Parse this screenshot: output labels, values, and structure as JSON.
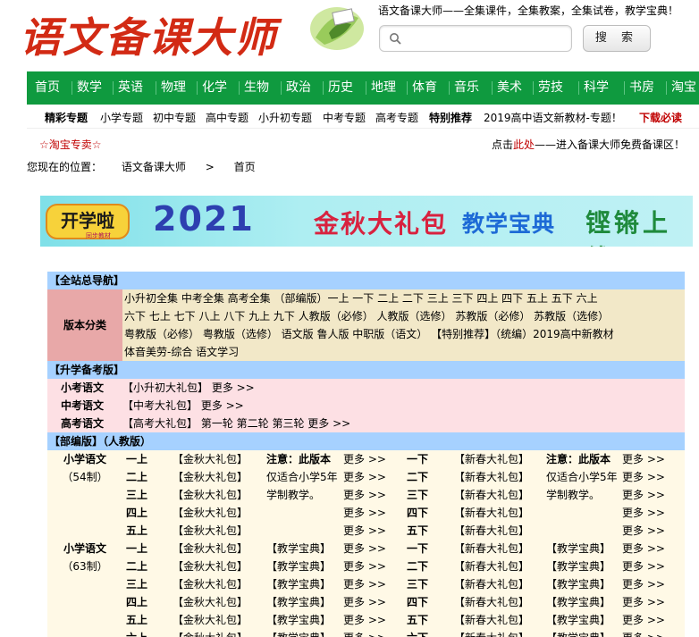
{
  "header": {
    "logo_text": "语文备课大师",
    "slogan": "语文备课大师——全集课件，全集教案，全集试卷，教学宝典！",
    "search_placeholder": "",
    "search_button": "搜 索"
  },
  "nav": {
    "items": [
      "首页",
      "数学",
      "英语",
      "物理",
      "化学",
      "生物",
      "政治",
      "历史",
      "地理",
      "体育",
      "音乐",
      "美术",
      "劳技",
      "科学",
      "书房",
      "淘宝"
    ]
  },
  "subbar": {
    "title": "精彩专题",
    "items": [
      "小学专题",
      "初中专题",
      "高中专题",
      "小升初专题",
      "中考专题",
      "高考专题"
    ],
    "special_label": "特别推荐",
    "special_text": "2019高中语文新教材-专题！",
    "download": "下载必读"
  },
  "promo": {
    "taobao": "☆淘宝专卖☆",
    "right_prefix": "点击",
    "right_link": "此处",
    "right_text": "——进入备课大师免费备课区！"
  },
  "breadcrumb": {
    "label": "您现在的位置：",
    "site": "语文备课大师",
    "sep": ">",
    "current": "首页"
  },
  "banner": {
    "logo": "开学啦",
    "logo_sub": "同步教材",
    "year": "2021",
    "t1": "金秋大礼包",
    "t2": "教学宝典",
    "t3": "铿锵上线"
  },
  "directory": {
    "nav_title": "【全站总导航】",
    "version_label": "版本分类",
    "version_lines": [
      "小升初全集  中考全集  高考全集  （部编版）一上  一下  二上  二下  三上  三下  四上  四下  五上  五下  六上",
      "六下  七上  七下  八上  八下  九上  九下  人教版（必修）  人教版（选修）  苏教版（必修）  苏教版（选修）",
      "粤教版（必修）  粤教版（选修）  语文版  鲁人版  中职版（语文）  【特别推荐】（统编）2019高中新教材",
      "体音美劳-综合  语文学习"
    ],
    "exam_title": "【升学备考版】",
    "exam_rows": [
      {
        "label": "小考语文",
        "value": "【小升初大礼包】 更多 >>"
      },
      {
        "label": "中考语文",
        "value": "【中考大礼包】 更多 >>"
      },
      {
        "label": "高考语文",
        "value": "【高考大礼包】 第一轮 第二轮 第三轮 更多 >>"
      }
    ],
    "bubian_title": "【部编版】（人教版）",
    "group1": {
      "label": "小学语文",
      "sub": "（54制）"
    },
    "group2": {
      "label": "小学语文",
      "sub": "（63制）"
    },
    "rows": [
      {
        "g1": "一上",
        "p1": "【金秋大礼包】",
        "n1": "注意：此版本",
        "m1": "更多 >>",
        "g2": "一下",
        "p2": "【新春大礼包】",
        "n2": "注意：此版本",
        "m2": "更多 >>"
      },
      {
        "g1": "二上",
        "p1": "【金秋大礼包】",
        "n1": "仅适合小学5年",
        "m1": "更多 >>",
        "g2": "二下",
        "p2": "【新春大礼包】",
        "n2": "仅适合小学5年",
        "m2": "更多 >>"
      },
      {
        "g1": "三上",
        "p1": "【金秋大礼包】",
        "n1": "学制教学。",
        "m1": "更多 >>",
        "g2": "三下",
        "p2": "【新春大礼包】",
        "n2": "学制教学。",
        "m2": "更多 >>"
      },
      {
        "g1": "四上",
        "p1": "【金秋大礼包】",
        "n1": "",
        "m1": "更多 >>",
        "g2": "四下",
        "p2": "【新春大礼包】",
        "n2": "",
        "m2": "更多 >>"
      },
      {
        "g1": "五上",
        "p1": "【金秋大礼包】",
        "n1": "",
        "m1": "更多 >>",
        "g2": "五下",
        "p2": "【新春大礼包】",
        "n2": "",
        "m2": "更多 >>"
      },
      {
        "g1": "一上",
        "p1": "【金秋大礼包】",
        "n1": "【教学宝典】",
        "m1": "更多 >>",
        "g2": "一下",
        "p2": "【新春大礼包】",
        "n2": "【教学宝典】",
        "m2": "更多 >>"
      },
      {
        "g1": "二上",
        "p1": "【金秋大礼包】",
        "n1": "【教学宝典】",
        "m1": "更多 >>",
        "g2": "二下",
        "p2": "【新春大礼包】",
        "n2": "【教学宝典】",
        "m2": "更多 >>"
      },
      {
        "g1": "三上",
        "p1": "【金秋大礼包】",
        "n1": "【教学宝典】",
        "m1": "更多 >>",
        "g2": "三下",
        "p2": "【新春大礼包】",
        "n2": "【教学宝典】",
        "m2": "更多 >>"
      },
      {
        "g1": "四上",
        "p1": "【金秋大礼包】",
        "n1": "【教学宝典】",
        "m1": "更多 >>",
        "g2": "四下",
        "p2": "【新春大礼包】",
        "n2": "【教学宝典】",
        "m2": "更多 >>"
      },
      {
        "g1": "五上",
        "p1": "【金秋大礼包】",
        "n1": "【教学宝典】",
        "m1": "更多 >>",
        "g2": "五下",
        "p2": "【新春大礼包】",
        "n2": "【教学宝典】",
        "m2": "更多 >>"
      },
      {
        "g1": "六上",
        "p1": "【金秋大礼包】",
        "n1": "【教学宝典】",
        "m1": "更多 >>",
        "g2": "六下",
        "p2": "【新春大礼包】",
        "n2": "【教学宝典】",
        "m2": "更多 >>"
      }
    ]
  },
  "colors": {
    "nav_green": "#0f9a3f",
    "logo_red": "#d22a14",
    "section_blue": "#a6d1ff",
    "label_pink": "#e8a8a8",
    "version_tan": "#f2e8c8",
    "exam_pink": "#fde0e4",
    "bubian_cream": "#fff9e6"
  }
}
